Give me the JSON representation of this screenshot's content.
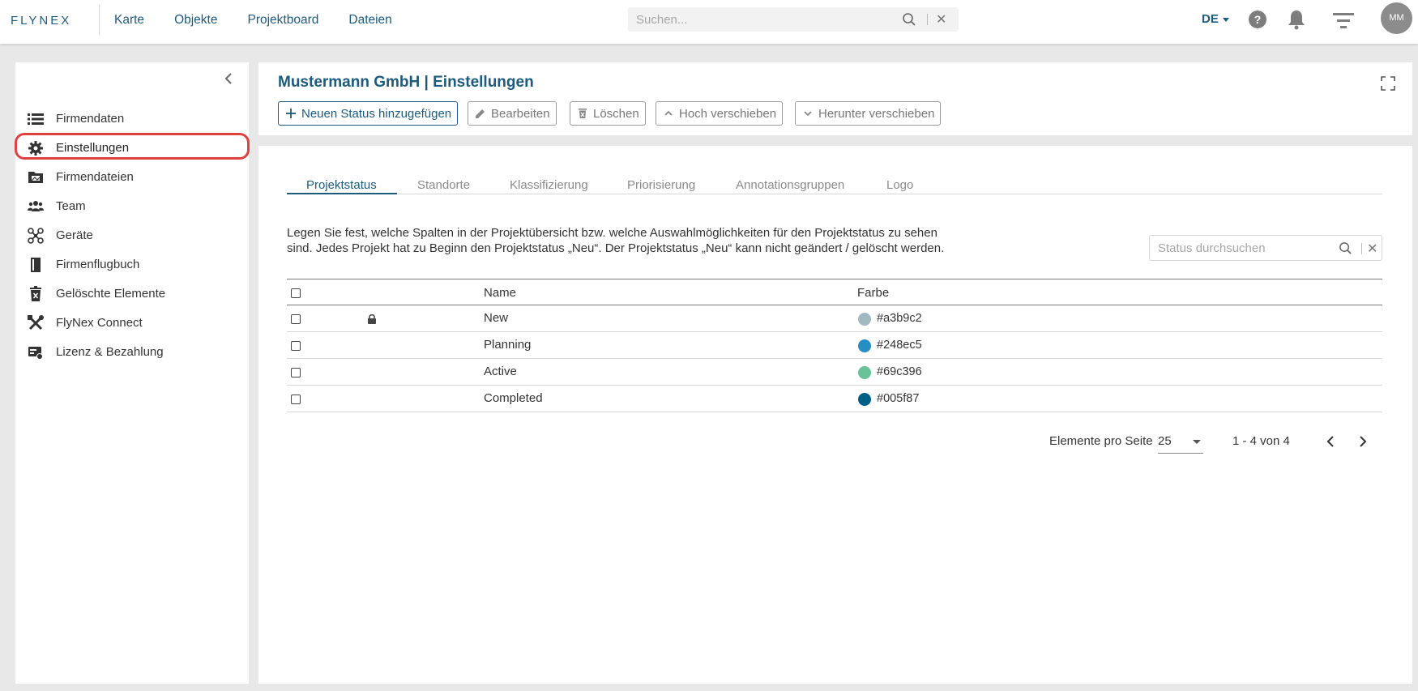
{
  "app": {
    "logo_text": "FLYNEX",
    "nav": [
      "Karte",
      "Objekte",
      "Projektboard",
      "Dateien"
    ],
    "search_placeholder": "Suchen...",
    "language": "DE",
    "avatar_initials": "MM"
  },
  "sidebar": {
    "items": [
      {
        "label": "Firmendaten",
        "icon": "list-icon"
      },
      {
        "label": "Einstellungen",
        "icon": "gear-icon",
        "active": true
      },
      {
        "label": "Firmendateien",
        "icon": "folder-icon"
      },
      {
        "label": "Team",
        "icon": "team-icon"
      },
      {
        "label": "Geräte",
        "icon": "drone-icon"
      },
      {
        "label": "Firmenflugbuch",
        "icon": "book-icon"
      },
      {
        "label": "Gelöschte Elemente",
        "icon": "trash-icon"
      },
      {
        "label": "FlyNex Connect",
        "icon": "tools-icon"
      },
      {
        "label": "Lizenz & Bezahlung",
        "icon": "license-icon"
      }
    ]
  },
  "header": {
    "title": "Mustermann GmbH | Einstellungen",
    "buttons": {
      "add": "Neuen Status hinzugefügen",
      "edit": "Bearbeiten",
      "delete": "Löschen",
      "move_up": "Hoch verschieben",
      "move_down": "Herunter verschieben"
    }
  },
  "tabs": [
    "Projektstatus",
    "Standorte",
    "Klassifizierung",
    "Priorisierung",
    "Annotationsgruppen",
    "Logo"
  ],
  "description": "Legen Sie fest, welche Spalten in der Projektübersicht bzw. welche Auswahlmöglichkeiten für den Projektstatus zu sehen sind. Jedes Projekt hat zu Beginn den Projektstatus „Neu“. Der Projektstatus „Neu“ kann nicht geändert / gelöscht werden.",
  "status_search_placeholder": "Status durchsuchen",
  "table": {
    "columns": {
      "name": "Name",
      "color": "Farbe"
    },
    "rows": [
      {
        "name": "New",
        "color": "#a3b9c2",
        "locked": true
      },
      {
        "name": "Planning",
        "color": "#248ec5",
        "locked": false
      },
      {
        "name": "Active",
        "color": "#69c396",
        "locked": false
      },
      {
        "name": "Completed",
        "color": "#005f87",
        "locked": false
      }
    ]
  },
  "pagination": {
    "label": "Elemente pro Seite",
    "page_size": "25",
    "range": "1 - 4 von 4"
  },
  "colors": {
    "brand": "#1c5a7e",
    "highlight": "#e04040"
  }
}
